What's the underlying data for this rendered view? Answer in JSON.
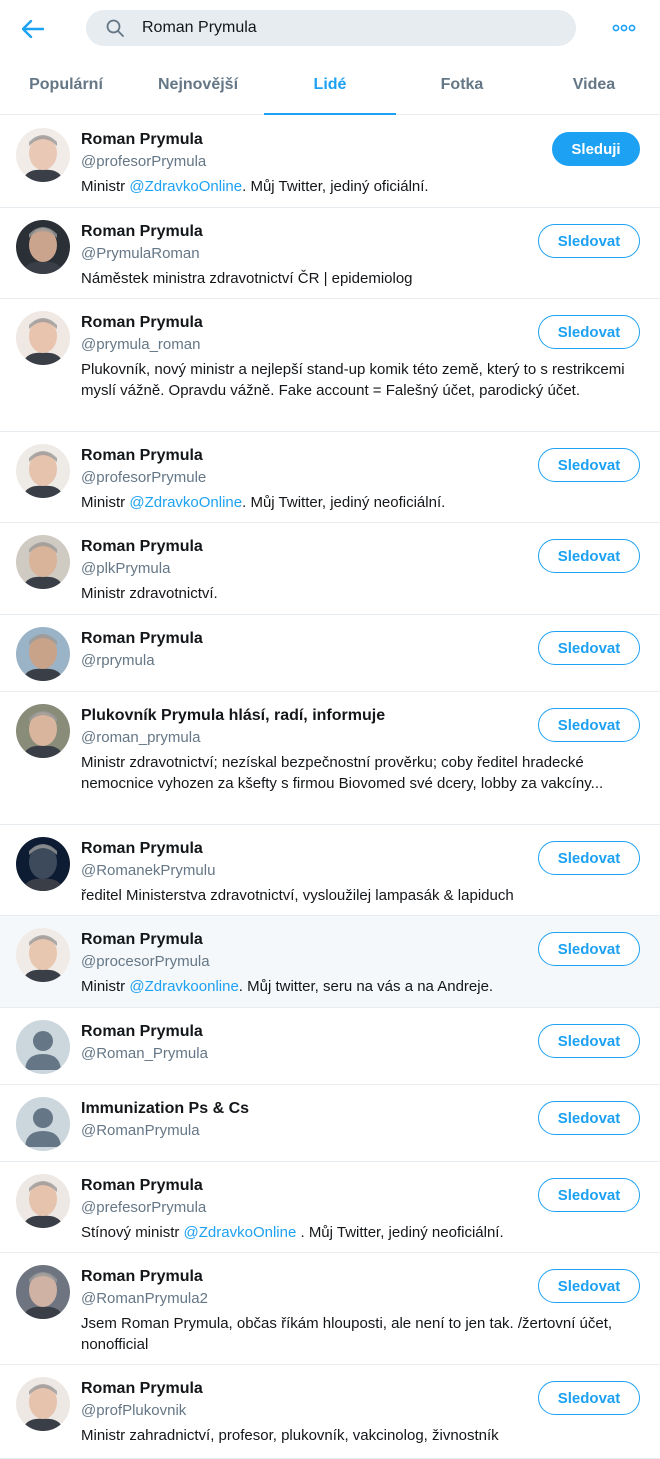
{
  "header": {
    "search_value": "Roman Prymula"
  },
  "tabs": [
    {
      "label": "Populární"
    },
    {
      "label": "Nejnovější"
    },
    {
      "label": "Lidé"
    },
    {
      "label": "Fotka"
    },
    {
      "label": "Videa"
    }
  ],
  "active_tab": "Lidé",
  "colors": {
    "accent": "#1da1f2",
    "text": "#14171a",
    "muted": "#657786",
    "divider": "#e6ecf0"
  },
  "users": [
    {
      "name": "Roman Prymula",
      "handle": "@profesorPrymula",
      "bio_before": "Ministr ",
      "bio_link": "@ZdravkoOnline",
      "bio_after": ". Můj Twitter, jediný oficiální.",
      "button": "Sleduji",
      "following": true,
      "avatar": "photo"
    },
    {
      "name": "Roman Prymula",
      "handle": "@PrymulaRoman",
      "bio_before": "Náměstek ministra zdravotnictví ČR | epidemiolog",
      "bio_link": "",
      "bio_after": "",
      "button": "Sledovat",
      "following": false,
      "avatar": "photo"
    },
    {
      "name": "Roman Prymula",
      "handle": "@prymula_roman",
      "bio_before": "Plukovník, nový ministr a nejlepší stand-up komik této země, který to s restrikcemi myslí vážně. Opravdu vážně. Fake account = Falešný účet, parodický účet.",
      "bio_link": "",
      "bio_after": "",
      "button": "Sledovat",
      "following": false,
      "avatar": "photo"
    },
    {
      "name": "Roman Prymula",
      "handle": "@profesorPrymule",
      "bio_before": "Ministr ",
      "bio_link": "@ZdravkoOnline",
      "bio_after": ". Můj Twitter, jediný neoficiální.",
      "button": "Sledovat",
      "following": false,
      "avatar": "photo"
    },
    {
      "name": "Roman Prymula",
      "handle": "@plkPrymula",
      "bio_before": "Ministr zdravotnictví.",
      "bio_link": "",
      "bio_after": "",
      "button": "Sledovat",
      "following": false,
      "avatar": "photo"
    },
    {
      "name": "Roman Prymula",
      "handle": "@rprymula",
      "bio_before": "",
      "bio_link": "",
      "bio_after": "",
      "button": "Sledovat",
      "following": false,
      "avatar": "photo"
    },
    {
      "name": "Plukovník Prymula hlásí, radí, informuje",
      "handle": "@roman_prymula",
      "bio_before": "Ministr zdravotnictví; nezískal bezpečnostní prověrku; coby ředitel hradecké nemocnice vyhozen za kšefty s firmou Biovomed své dcery, lobby za vakcíny...",
      "bio_link": "",
      "bio_after": "",
      "button": "Sledovat",
      "following": false,
      "avatar": "photo"
    },
    {
      "name": "Roman Prymula",
      "handle": "@RomanekPrymulu",
      "bio_before": "ředitel Ministerstva zdravotnictví, vysloužilej lampasák & lapiduch",
      "bio_link": "",
      "bio_after": "",
      "button": "Sledovat",
      "following": false,
      "avatar": "photo"
    },
    {
      "name": "Roman Prymula",
      "handle": "@procesorPrymula",
      "bio_before": "Ministr ",
      "bio_link": "@Zdravkoonline",
      "bio_after": ". Můj twitter, seru na vás a na Andreje.",
      "button": "Sledovat",
      "following": false,
      "avatar": "photo"
    },
    {
      "name": "Roman Prymula",
      "handle": "@Roman_Prymula",
      "bio_before": "",
      "bio_link": "",
      "bio_after": "",
      "button": "Sledovat",
      "following": false,
      "avatar": "default"
    },
    {
      "name": "Immunization Ps & Cs",
      "handle": "@RomanPrymula",
      "bio_before": "",
      "bio_link": "",
      "bio_after": "",
      "button": "Sledovat",
      "following": false,
      "avatar": "default"
    },
    {
      "name": "Roman Prymula",
      "handle": "@prefesorPrymula",
      "bio_before": "Stínový ministr ",
      "bio_link": "@ZdravkoOnline",
      "bio_after": " . Můj Twitter, jediný neoficiální.",
      "button": "Sledovat",
      "following": false,
      "avatar": "photo"
    },
    {
      "name": "Roman Prymula",
      "handle": "@RomanPrymula2",
      "bio_before": "Jsem Roman Prymula, občas říkám hlouposti, ale není to jen tak. /žertovní účet, nonofficial",
      "bio_link": "",
      "bio_after": "",
      "button": "Sledovat",
      "following": false,
      "avatar": "photo"
    },
    {
      "name": "Roman Prymula",
      "handle": "@profPlukovnik",
      "bio_before": "Ministr zahradnictví, profesor, plukovník, vakcinolog, živnostník",
      "bio_link": "",
      "bio_after": "",
      "button": "Sledovat",
      "following": false,
      "avatar": "photo"
    }
  ]
}
